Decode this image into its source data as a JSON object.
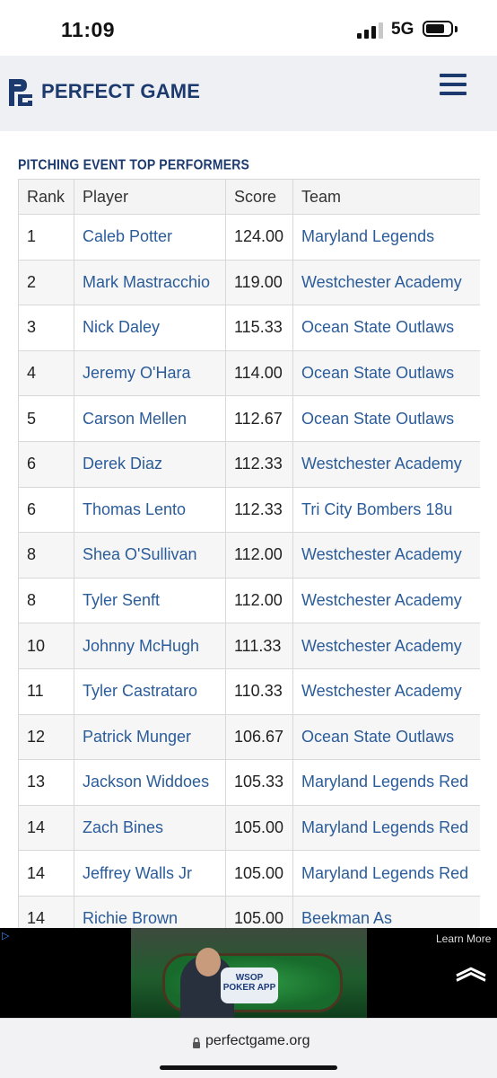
{
  "status_bar": {
    "time": "11:09",
    "network": "5G"
  },
  "header": {
    "brand": "PERFECT GAME",
    "logo_icon": "pg-logo-icon",
    "menu_icon": "hamburger-menu-icon"
  },
  "section": {
    "title": "PITCHING EVENT TOP PERFORMERS"
  },
  "table": {
    "columns": [
      "Rank",
      "Player",
      "Score",
      "Team"
    ],
    "rows": [
      {
        "rank": "1",
        "player": "Caleb Potter",
        "score": "124.00",
        "team": "Maryland Legends"
      },
      {
        "rank": "2",
        "player": "Mark Mastracchio",
        "score": "119.00",
        "team": "Westchester Academy"
      },
      {
        "rank": "3",
        "player": "Nick Daley",
        "score": "115.33",
        "team": "Ocean State Outlaws"
      },
      {
        "rank": "4",
        "player": "Jeremy O'Hara",
        "score": "114.00",
        "team": "Ocean State Outlaws"
      },
      {
        "rank": "5",
        "player": "Carson Mellen",
        "score": "112.67",
        "team": "Ocean State Outlaws"
      },
      {
        "rank": "6",
        "player": "Derek Diaz",
        "score": "112.33",
        "team": "Westchester Academy"
      },
      {
        "rank": "6",
        "player": "Thomas Lento",
        "score": "112.33",
        "team": "Tri City Bombers 18u"
      },
      {
        "rank": "8",
        "player": "Shea O'Sullivan",
        "score": "112.00",
        "team": "Westchester Academy"
      },
      {
        "rank": "8",
        "player": "Tyler Senft",
        "score": "112.00",
        "team": "Westchester Academy"
      },
      {
        "rank": "10",
        "player": "Johnny McHugh",
        "score": "111.33",
        "team": "Westchester Academy"
      },
      {
        "rank": "11",
        "player": "Tyler Castrataro",
        "score": "110.33",
        "team": "Westchester Academy"
      },
      {
        "rank": "12",
        "player": "Patrick Munger",
        "score": "106.67",
        "team": "Ocean State Outlaws"
      },
      {
        "rank": "13",
        "player": "Jackson Widdoes",
        "score": "105.33",
        "team": "Maryland Legends Red"
      },
      {
        "rank": "14",
        "player": "Zach Bines",
        "score": "105.00",
        "team": "Maryland Legends Red"
      },
      {
        "rank": "14",
        "player": "Jeffrey Walls Jr",
        "score": "105.00",
        "team": "Maryland Legends Red"
      },
      {
        "rank": "14",
        "player": "Richie Brown",
        "score": "105.00",
        "team": "Beekman As"
      }
    ]
  },
  "ad": {
    "learn_more": "Learn More",
    "badge": "WSOP POKER APP"
  },
  "url_bar": {
    "url": "perfectgame.org"
  },
  "colors": {
    "brand_navy": "#1c3a6e",
    "link_blue": "#2b5c9a",
    "header_bg": "#eef0f3"
  }
}
